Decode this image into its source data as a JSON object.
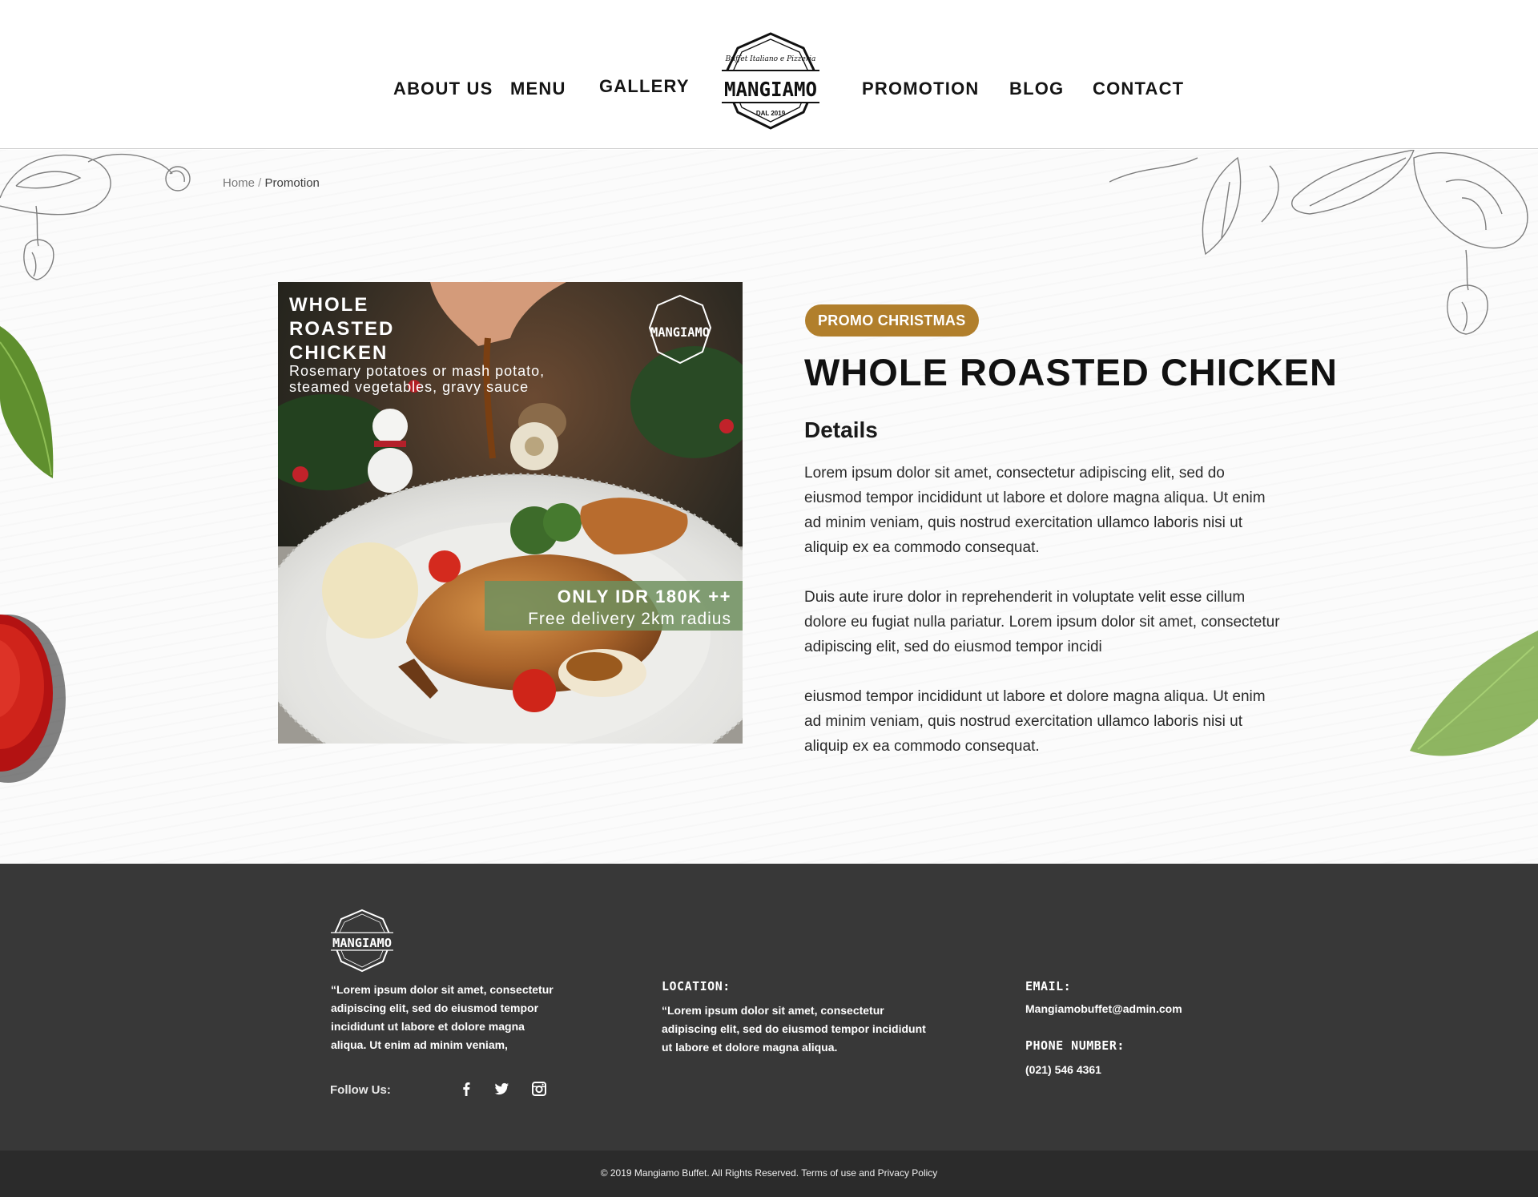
{
  "nav": {
    "left": [
      "ABOUT US",
      "MENU",
      "GALLERY"
    ],
    "right": [
      "PROMOTION",
      "BLOG",
      "CONTACT"
    ]
  },
  "logo": {
    "name": "MANGIAMO",
    "tagline": "Buffet Italiano e Pizzeria",
    "since": "DAL 2019"
  },
  "breadcrumb": {
    "home": "Home",
    "separator": " / ",
    "current": "Promotion"
  },
  "promo_image": {
    "title_lines": [
      "WHOLE",
      "ROASTED",
      "CHICKEN"
    ],
    "subtitle_lines": [
      "Rosemary potatoes or mash potato,",
      "steamed vegetables, gravy sauce"
    ],
    "price": "ONLY IDR 180K ++",
    "delivery": "Free delivery 2km radius"
  },
  "promo": {
    "badge": "PROMO CHRISTMAS",
    "title": "WHOLE ROASTED CHICKEN",
    "details_heading": "Details",
    "paragraphs": [
      "Lorem ipsum dolor sit amet, consectetur adipiscing elit, sed do eiusmod tempor incididunt ut labore et dolore magna aliqua. Ut enim ad minim veniam, quis nostrud exercitation ullamco laboris nisi ut aliquip ex ea commodo consequat.",
      "Duis aute irure dolor in reprehenderit in voluptate velit esse cillum dolore eu fugiat nulla pariatur. Lorem ipsum dolor sit amet, consectetur adipiscing elit, sed do eiusmod tempor incidi",
      "eiusmod tempor incididunt ut labore et dolore magna aliqua. Ut enim ad minim veniam, quis nostrud exercitation ullamco laboris nisi ut aliquip ex ea commodo consequat."
    ]
  },
  "footer": {
    "quote": "“Lorem ipsum dolor sit amet, consectetur adipiscing elit, sed do eiusmod tempor incididunt ut labore et dolore magna aliqua. Ut enim ad minim veniam,",
    "follow_label": "Follow Us:",
    "social_icons": [
      "facebook-icon",
      "twitter-icon",
      "instagram-icon"
    ],
    "location_label": "LOCATION:",
    "location_text": "“Lorem ipsum dolor sit amet, consectetur adipiscing elit, sed do eiusmod tempor incididunt ut labore et dolore magna aliqua.",
    "email_label": "EMAIL:",
    "email": "Mangiamobuffet@admin.com",
    "phone_label": "PHONE NUMBER:",
    "phone": "(021) 546 4361",
    "copyright": "© 2019 Mangiamo Buffet. All Rights Reserved. Terms of use and Privacy Policy"
  },
  "colors": {
    "badge": "#b17f2c",
    "footer_bg": "#383838",
    "copyright_bg": "#2b2b2b",
    "price_banner": "#6f8f5e"
  }
}
